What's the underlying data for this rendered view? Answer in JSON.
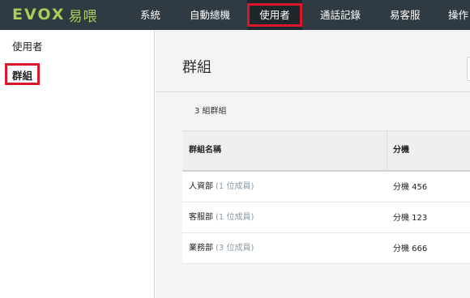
{
  "brand": {
    "logo_text": "EVOX",
    "logo_cn": "易喂"
  },
  "nav": {
    "items": [
      {
        "label": "系統"
      },
      {
        "label": "自動總機"
      },
      {
        "label": "使用者"
      },
      {
        "label": "通話記錄"
      },
      {
        "label": "易客服"
      },
      {
        "label": "操作"
      }
    ],
    "active_index": 2
  },
  "sidebar": {
    "items": [
      {
        "label": "使用者"
      },
      {
        "label": "群組"
      }
    ],
    "active_index": 1
  },
  "main": {
    "title": "群組",
    "count_text": "3 組群組",
    "table": {
      "headers": [
        "群組名稱",
        "分機"
      ],
      "rows": [
        {
          "name": "人資部",
          "members": "(1 位成員)",
          "extension": "分機 456"
        },
        {
          "name": "客服部",
          "members": "(1 位成員)",
          "extension": "分機 123"
        },
        {
          "name": "業務部",
          "members": "(3 位成員)",
          "extension": "分機 666"
        }
      ]
    }
  },
  "colors": {
    "nav_bg": "#2f3a42",
    "brand_green": "#a6cf5a",
    "highlight_red": "#d9182b",
    "member_gray": "#8a9aa8"
  }
}
